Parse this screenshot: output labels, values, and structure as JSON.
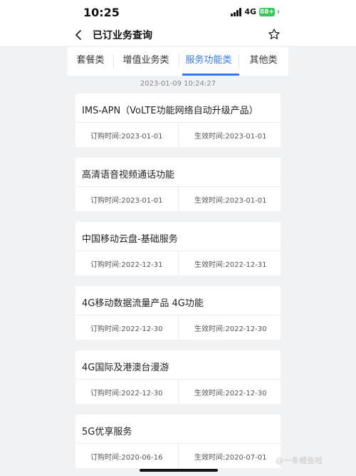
{
  "status": {
    "time": "10:25",
    "network": "4G",
    "battery": "88+"
  },
  "nav": {
    "title": "已订业务查询",
    "back_icon": "chevron-left-icon",
    "fav_icon": "star-outline-icon"
  },
  "tabs": [
    {
      "label": "套餐类",
      "active": false
    },
    {
      "label": "增值业务类",
      "active": false
    },
    {
      "label": "服务功能类",
      "active": true
    },
    {
      "label": "其他类",
      "active": false
    }
  ],
  "colors": {
    "accent": "#2f7bf5",
    "battery": "#34c759",
    "background": "#f1f2f4"
  },
  "query_time": "2023-01-09 10:24:27",
  "services": [
    {
      "name": "IMS-APN（VoLTE功能网络自动升级产品）",
      "order": "订购时间:2023-01-01",
      "effective": "生效时间:2023-01-01"
    },
    {
      "name": "高清语音视频通话功能",
      "order": "订购时间:2023-01-01",
      "effective": "生效时间:2023-01-01"
    },
    {
      "name": "中国移动云盘-基础服务",
      "order": "订购时间:2022-12-31",
      "effective": "生效时间:2022-12-31"
    },
    {
      "name": "4G移动数据流量产品 4G功能",
      "order": "订购时间:2022-12-30",
      "effective": "生效时间:2022-12-30"
    },
    {
      "name": "4G国际及港澳台漫游",
      "order": "订购时间:2022-12-30",
      "effective": "生效时间:2022-12-30"
    },
    {
      "name": "5G优享服务",
      "order": "订购时间:2020-06-16",
      "effective": "生效时间:2020-07-01"
    }
  ],
  "watermark": "@一条鲤鱼啦"
}
